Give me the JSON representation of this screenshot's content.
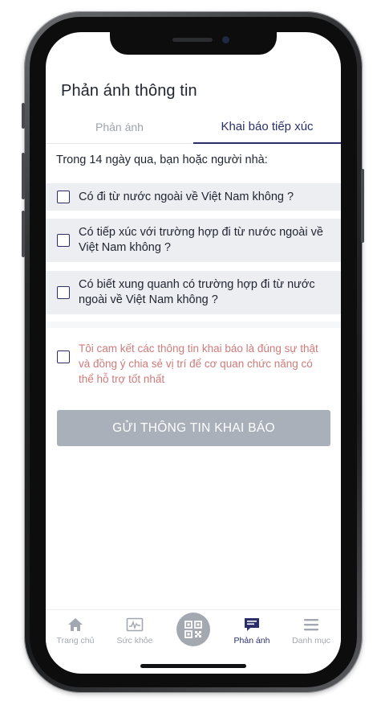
{
  "header": {
    "title": "Phản ánh thông tin"
  },
  "tabs": [
    {
      "label": "Phản ánh",
      "active": false
    },
    {
      "label": "Khai báo tiếp xúc",
      "active": true
    }
  ],
  "form": {
    "intro": "Trong 14 ngày qua, bạn hoặc người nhà:",
    "questions": [
      {
        "text": "Có đi từ nước ngoài về Việt Nam không ?",
        "checked": false
      },
      {
        "text": "Có tiếp xúc với trường hợp đi từ nước ngoài về Việt Nam không ?",
        "checked": false
      },
      {
        "text": "Có biết xung quanh có trường hợp đi từ nước ngoài về Việt Nam không ?",
        "checked": false
      }
    ],
    "commitment": {
      "text": "Tôi cam kết các thông tin khai báo là đúng sự thật và đồng ý chia sẻ vị trí để cơ quan chức năng có thể hỗ trợ tốt nhất",
      "checked": false
    },
    "submit_label": "GỬI THÔNG TIN KHAI BÁO"
  },
  "bottom_nav": {
    "items": [
      {
        "label": "Trang chủ",
        "icon": "home-icon",
        "active": false
      },
      {
        "label": "Sức khỏe",
        "icon": "health-chart-icon",
        "active": false
      },
      {
        "label": "Phản ánh",
        "icon": "feedback-icon",
        "active": true
      },
      {
        "label": "Danh mục",
        "icon": "menu-icon",
        "active": false
      }
    ],
    "center_icon": "qr-code-icon"
  },
  "colors": {
    "accent": "#2a2f6b",
    "commitment_text": "#d07a7a",
    "button_disabled": "#a9b0ba",
    "row_background": "#eceef1"
  }
}
